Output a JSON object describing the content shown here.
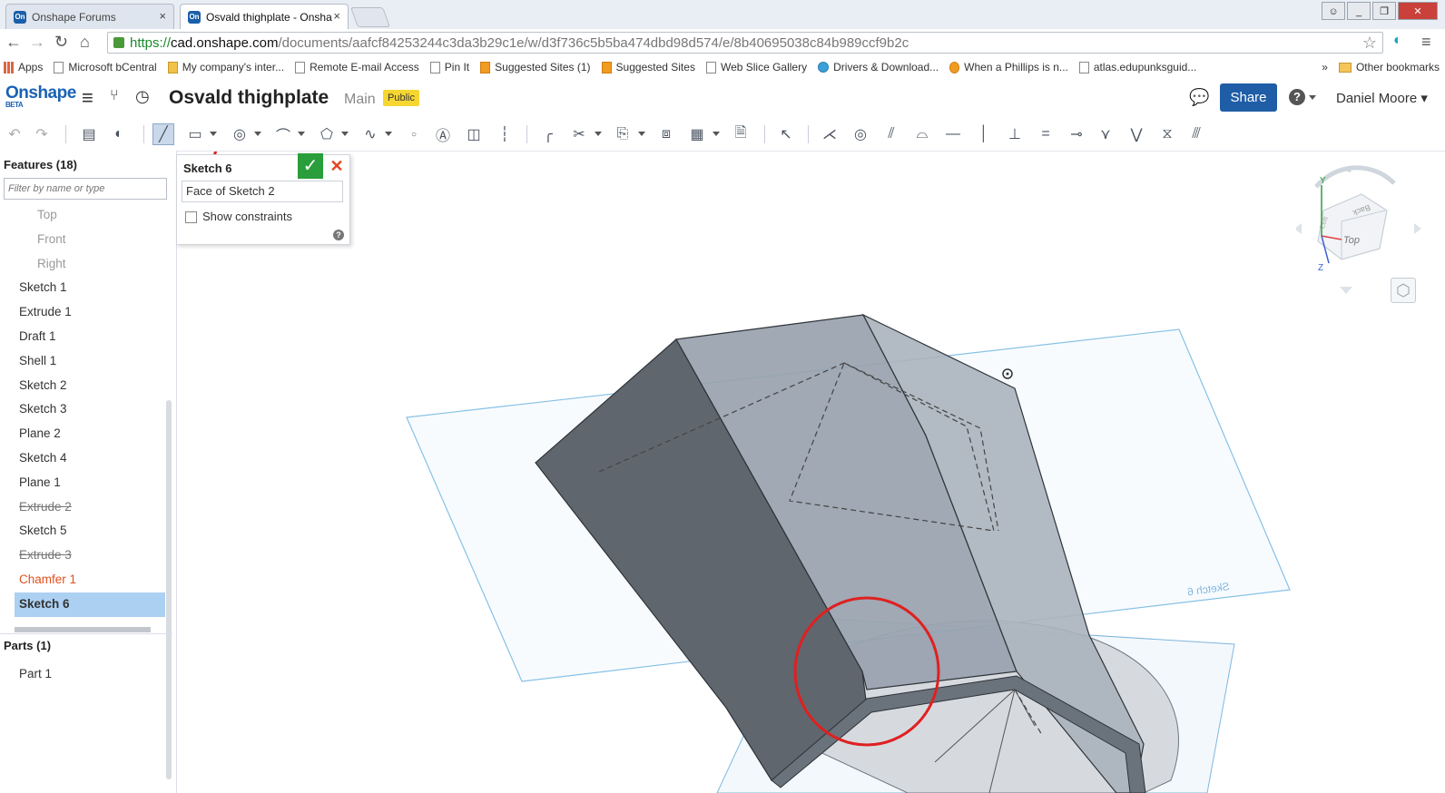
{
  "browser": {
    "tabs": [
      {
        "label": "Onshape Forums",
        "favicon": "On",
        "close": "×"
      },
      {
        "label": "Osvald thighplate - Onsha",
        "favicon": "On",
        "close": "×"
      }
    ],
    "url": {
      "scheme": "https://",
      "host": "cad.onshape.com",
      "path": "/documents/aafcf84253244c3da3b29c1e/w/d3f736c5b5ba474dbd98d574/e/8b40695038c84b989ccf9b2c"
    },
    "bookmarks": [
      "Apps",
      "Microsoft bCentral",
      "My company's inter...",
      "Remote E-mail Access",
      "Pin It",
      "Suggested Sites (1)",
      "Suggested Sites",
      "Web Slice Gallery",
      "Drivers & Download...",
      "When a Phillips is n...",
      "atlas.edupunksguid..."
    ],
    "bookmarks_more": "»",
    "other_bookmarks": "Other bookmarks"
  },
  "app": {
    "logo": "Onshape",
    "logo_sub": "BETA",
    "document_title": "Osvald thighplate",
    "branch": "Main",
    "visibility_badge": "Public",
    "share_label": "Share",
    "user_name": "Daniel Moore ▾",
    "help_label": "?"
  },
  "feature_panel": {
    "header": "Features (18)",
    "filter_placeholder": "Filter by name or type",
    "features": [
      {
        "label": "Top",
        "state": "dim"
      },
      {
        "label": "Front",
        "state": "dim"
      },
      {
        "label": "Right",
        "state": "dim"
      },
      {
        "label": "Sketch 1",
        "state": "normal"
      },
      {
        "label": "Extrude 1",
        "state": "normal"
      },
      {
        "label": "Draft 1",
        "state": "normal"
      },
      {
        "label": "Shell 1",
        "state": "normal"
      },
      {
        "label": "Sketch 2",
        "state": "normal"
      },
      {
        "label": "Sketch 3",
        "state": "normal"
      },
      {
        "label": "Plane 2",
        "state": "normal"
      },
      {
        "label": "Sketch 4",
        "state": "normal"
      },
      {
        "label": "Plane 1",
        "state": "normal"
      },
      {
        "label": "Extrude 2",
        "state": "suppressed"
      },
      {
        "label": "Sketch 5",
        "state": "normal"
      },
      {
        "label": "Extrude 3",
        "state": "suppressed"
      },
      {
        "label": "Chamfer 1",
        "state": "error"
      },
      {
        "label": "Sketch 6",
        "state": "selected"
      }
    ],
    "parts_header": "Parts (1)",
    "parts": [
      "Part 1"
    ]
  },
  "sketch_dialog": {
    "title": "Sketch 6",
    "ok": "✓",
    "cancel": "✕",
    "plane_field": "Face of Sketch 2",
    "show_constraints_label": "Show constraints",
    "show_constraints_checked": false,
    "help": "?"
  },
  "viewport": {
    "sketch_plane_label": "Sketch 6",
    "viewcube_faces": [
      "Top",
      "Back",
      "Left"
    ],
    "axes": [
      "Y",
      "Z"
    ]
  },
  "colors": {
    "onshape_blue": "#1a62b4",
    "share_button": "#1f5da6",
    "public_badge": "#f6d631",
    "accept_green": "#2a9e3a",
    "error_orange": "#e0501f",
    "selected_row": "#acd0f2",
    "annotation_red": "#e02020"
  }
}
